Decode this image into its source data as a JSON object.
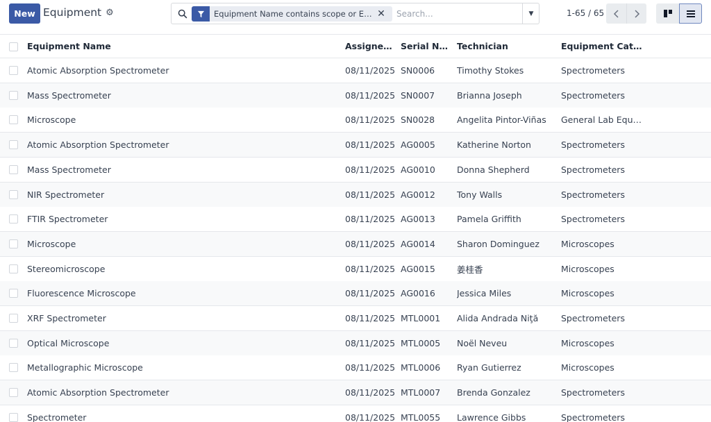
{
  "control_panel": {
    "new_label": "New",
    "title": "Equipment",
    "search": {
      "facet_text": "Equipment Name contains scope or Equipment Name contains meter",
      "placeholder": "Search..."
    },
    "pager": {
      "value": "1-65 / 65"
    }
  },
  "colors": {
    "accent": "#3b5aa6",
    "row_alt": "#f8f9fa",
    "border": "#e5e7eb"
  },
  "icons": {
    "settings": "gear-icon",
    "search": "search-icon",
    "filter": "filter-icon",
    "remove": "close-icon",
    "dropdown": "caret-down-icon",
    "prev": "chevron-left-icon",
    "next": "chevron-right-icon",
    "kanban": "kanban-view-icon",
    "list": "list-view-icon"
  },
  "table": {
    "columns": [
      "Equipment Name",
      "Assigned Date",
      "Serial Number",
      "Technician",
      "Equipment Category"
    ],
    "columns_display": [
      "Equipment Name",
      "Assigned ...",
      "Serial Nu...",
      "Technician",
      "Equipment Category"
    ],
    "rows": [
      [
        "Atomic Absorption Spectrometer",
        "08/11/2025",
        "SN0006",
        "Timothy Stokes",
        "Spectrometers"
      ],
      [
        "Mass Spectrometer",
        "08/11/2025",
        "SN0007",
        "Brianna Joseph",
        "Spectrometers"
      ],
      [
        "Microscope",
        "08/11/2025",
        "SN0028",
        "Angelita Pintor-Viñas",
        "General Lab Equipment"
      ],
      [
        "Atomic Absorption Spectrometer",
        "08/11/2025",
        "AG0005",
        "Katherine Norton",
        "Spectrometers"
      ],
      [
        "Mass Spectrometer",
        "08/11/2025",
        "AG0010",
        "Donna Shepherd",
        "Spectrometers"
      ],
      [
        "NIR Spectrometer",
        "08/11/2025",
        "AG0012",
        "Tony Walls",
        "Spectrometers"
      ],
      [
        "FTIR Spectrometer",
        "08/11/2025",
        "AG0013",
        "Pamela Griffith",
        "Spectrometers"
      ],
      [
        "Microscope",
        "08/11/2025",
        "AG0014",
        "Sharon Dominguez",
        "Microscopes"
      ],
      [
        "Stereomicroscope",
        "08/11/2025",
        "AG0015",
        "姜桂香",
        "Microscopes"
      ],
      [
        "Fluorescence Microscope",
        "08/11/2025",
        "AG0016",
        "Jessica Miles",
        "Microscopes"
      ],
      [
        "XRF Spectrometer",
        "08/11/2025",
        "MTL0001",
        "Alida Andrada Niţă",
        "Spectrometers"
      ],
      [
        "Optical Microscope",
        "08/11/2025",
        "MTL0005",
        "Noël Neveu",
        "Microscopes"
      ],
      [
        "Metallographic Microscope",
        "08/11/2025",
        "MTL0006",
        "Ryan Gutierrez",
        "Microscopes"
      ],
      [
        "Atomic Absorption Spectrometer",
        "08/11/2025",
        "MTL0007",
        "Brenda Gonzalez",
        "Spectrometers"
      ],
      [
        "Spectrometer",
        "08/11/2025",
        "MTL0055",
        "Lawrence Gibbs",
        "Spectrometers"
      ]
    ]
  }
}
